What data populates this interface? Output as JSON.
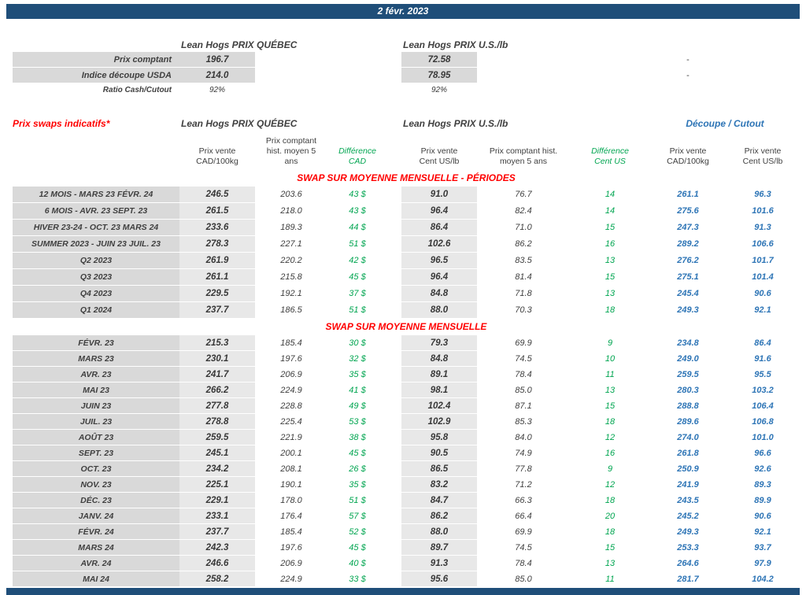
{
  "header": {
    "date": "2 févr. 2023"
  },
  "colors": {
    "navy": "#1F4E79",
    "red": "#FF0000",
    "green": "#00A550",
    "blue": "#2E75B6",
    "gray_label": "#D9D9D9",
    "gray_value": "#E8E8E8"
  },
  "spot": {
    "quebec_title": "Lean Hogs PRIX QUÉBEC",
    "us_title": "Lean Hogs PRIX U.S./lb",
    "rows": [
      {
        "label": "Prix comptant",
        "quebec": "196.7",
        "us": "72.58",
        "cutout": "-"
      },
      {
        "label": "Indice découpe USDA",
        "quebec": "214.0",
        "us": "78.95",
        "cutout": "-"
      },
      {
        "label": "Ratio Cash/Cutout",
        "quebec": "92%",
        "us": "92%",
        "cutout": ""
      }
    ]
  },
  "swaps": {
    "title": "Prix swaps indicatifs*",
    "quebec_title": "Lean Hogs PRIX QUÉBEC",
    "us_title": "Lean Hogs PRIX U.S./lb",
    "cutout_title": "Découpe / Cutout",
    "column_headers": [
      "Prix vente\nCAD/100kg",
      "Prix comptant\nhist. moyen 5\nans",
      "Différence\nCAD",
      "Prix vente\nCent US/lb",
      "Prix comptant hist.\nmoyen 5 ans",
      "Différence\nCent US",
      "Prix vente\nCAD/100kg",
      "Prix vente\nCent US/lb"
    ],
    "sections": [
      {
        "header": "SWAP SUR MOYENNE MENSUELLE - PÉRIODES",
        "rows": [
          {
            "label": "12 MOIS - MARS 23 FÉVR. 24",
            "values": [
              "246.5",
              "203.6",
              "43 $",
              "91.0",
              "76.7",
              "14",
              "261.1",
              "96.3"
            ]
          },
          {
            "label": "6 MOIS - AVR. 23 SEPT. 23",
            "values": [
              "261.5",
              "218.0",
              "43 $",
              "96.4",
              "82.4",
              "14",
              "275.6",
              "101.6"
            ]
          },
          {
            "label": "HIVER 23-24 -  OCT. 23 MARS 24",
            "values": [
              "233.6",
              "189.3",
              "44 $",
              "86.4",
              "71.0",
              "15",
              "247.3",
              "91.3"
            ]
          },
          {
            "label": "SUMMER 2023 - JUIN 23 JUIL. 23",
            "values": [
              "278.3",
              "227.1",
              "51 $",
              "102.6",
              "86.2",
              "16",
              "289.2",
              "106.6"
            ]
          },
          {
            "label": "Q2 2023",
            "values": [
              "261.9",
              "220.2",
              "42 $",
              "96.5",
              "83.5",
              "13",
              "276.2",
              "101.7"
            ]
          },
          {
            "label": "Q3 2023",
            "values": [
              "261.1",
              "215.8",
              "45 $",
              "96.4",
              "81.4",
              "15",
              "275.1",
              "101.4"
            ]
          },
          {
            "label": "Q4 2023",
            "values": [
              "229.5",
              "192.1",
              "37 $",
              "84.8",
              "71.8",
              "13",
              "245.4",
              "90.6"
            ]
          },
          {
            "label": "Q1 2024",
            "values": [
              "237.7",
              "186.5",
              "51 $",
              "88.0",
              "70.3",
              "18",
              "249.3",
              "92.1"
            ]
          }
        ]
      },
      {
        "header": "SWAP SUR MOYENNE MENSUELLE",
        "rows": [
          {
            "label": "FÉVR. 23",
            "values": [
              "215.3",
              "185.4",
              "30 $",
              "79.3",
              "69.9",
              "9",
              "234.8",
              "86.4"
            ]
          },
          {
            "label": "MARS 23",
            "values": [
              "230.1",
              "197.6",
              "32 $",
              "84.8",
              "74.5",
              "10",
              "249.0",
              "91.6"
            ]
          },
          {
            "label": "AVR. 23",
            "values": [
              "241.7",
              "206.9",
              "35 $",
              "89.1",
              "78.4",
              "11",
              "259.5",
              "95.5"
            ]
          },
          {
            "label": "MAI 23",
            "values": [
              "266.2",
              "224.9",
              "41 $",
              "98.1",
              "85.0",
              "13",
              "280.3",
              "103.2"
            ]
          },
          {
            "label": "JUIN 23",
            "values": [
              "277.8",
              "228.8",
              "49 $",
              "102.4",
              "87.1",
              "15",
              "288.8",
              "106.4"
            ]
          },
          {
            "label": "JUIL. 23",
            "values": [
              "278.8",
              "225.4",
              "53 $",
              "102.9",
              "85.3",
              "18",
              "289.6",
              "106.8"
            ]
          },
          {
            "label": "AOÛT 23",
            "values": [
              "259.5",
              "221.9",
              "38 $",
              "95.8",
              "84.0",
              "12",
              "274.0",
              "101.0"
            ]
          },
          {
            "label": "SEPT. 23",
            "values": [
              "245.1",
              "200.1",
              "45 $",
              "90.5",
              "74.9",
              "16",
              "261.8",
              "96.6"
            ]
          },
          {
            "label": "OCT. 23",
            "values": [
              "234.2",
              "208.1",
              "26 $",
              "86.5",
              "77.8",
              "9",
              "250.9",
              "92.6"
            ]
          },
          {
            "label": "NOV. 23",
            "values": [
              "225.1",
              "190.1",
              "35 $",
              "83.2",
              "71.2",
              "12",
              "241.9",
              "89.3"
            ]
          },
          {
            "label": "DÉC. 23",
            "values": [
              "229.1",
              "178.0",
              "51 $",
              "84.7",
              "66.3",
              "18",
              "243.5",
              "89.9"
            ]
          },
          {
            "label": "JANV. 24",
            "values": [
              "233.1",
              "176.4",
              "57 $",
              "86.2",
              "66.4",
              "20",
              "245.2",
              "90.6"
            ]
          },
          {
            "label": "FÉVR. 24",
            "values": [
              "237.7",
              "185.4",
              "52 $",
              "88.0",
              "69.9",
              "18",
              "249.3",
              "92.1"
            ]
          },
          {
            "label": "MARS 24",
            "values": [
              "242.3",
              "197.6",
              "45 $",
              "89.7",
              "74.5",
              "15",
              "253.3",
              "93.7"
            ]
          },
          {
            "label": "AVR. 24",
            "values": [
              "246.6",
              "206.9",
              "40 $",
              "91.3",
              "78.4",
              "13",
              "264.6",
              "97.9"
            ]
          },
          {
            "label": "MAI 24",
            "values": [
              "258.2",
              "224.9",
              "33 $",
              "95.6",
              "85.0",
              "11",
              "281.7",
              "104.2"
            ]
          }
        ]
      }
    ]
  }
}
